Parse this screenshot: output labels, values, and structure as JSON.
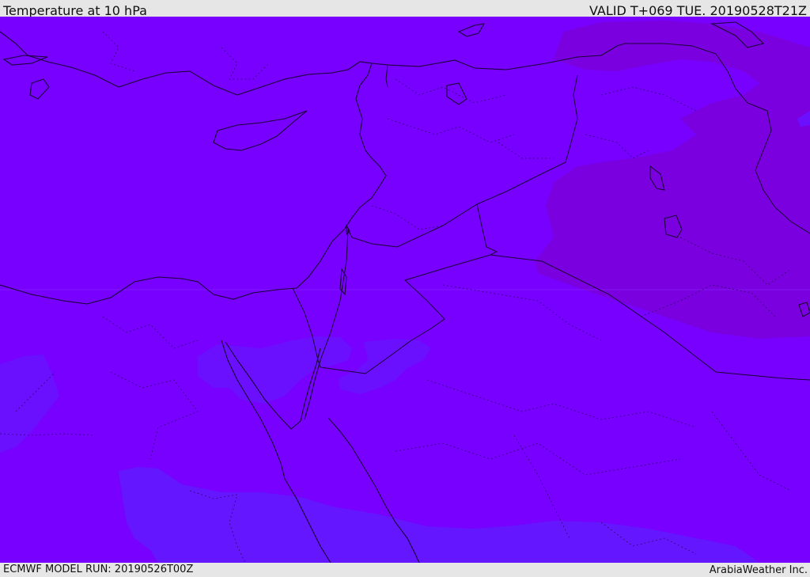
{
  "header": {
    "title": "Temperature at 10 hPa",
    "valid_time": "VALID T+069 TUE. 20190528T21Z"
  },
  "footer": {
    "model_run": "ECMWF MODEL RUN: 20190526T00Z",
    "credit": "ArabiaWeather Inc."
  },
  "colors": {
    "base_field": "#7700ff",
    "warm_field": "#7a00e0",
    "cool_field": "#6417ff",
    "coastline": "#1a0033"
  }
}
